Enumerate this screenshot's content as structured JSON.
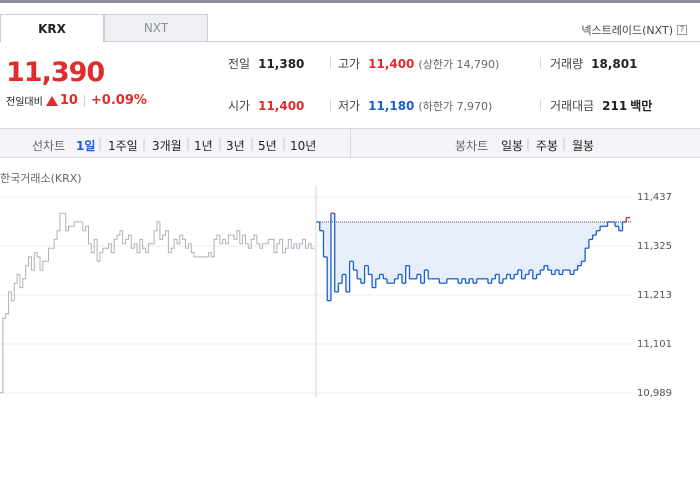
{
  "tabs": [
    {
      "label": "KRX",
      "active": true
    },
    {
      "label": "NXT",
      "active": false
    }
  ],
  "nxt_link": {
    "label": "넥스트레이드(NXT)",
    "help": "?"
  },
  "price": {
    "current": "11,390",
    "change_label": "전일대비",
    "change_value": "10",
    "change_percent": "+0.09%",
    "direction": "up"
  },
  "summary": {
    "prev_close": {
      "label": "전일",
      "value": "11,380"
    },
    "high": {
      "label": "고가",
      "value": "11,400",
      "sub": "(상한가 14,790)"
    },
    "volume": {
      "label": "거래량",
      "value": "18,801"
    },
    "open": {
      "label": "시가",
      "value": "11,400"
    },
    "low": {
      "label": "저가",
      "value": "11,180",
      "sub": "(하한가 7,970)"
    },
    "amount": {
      "label": "거래대금",
      "value": "211",
      "unit": "백만"
    }
  },
  "line_chart_tabs": {
    "label": "선차트",
    "items": [
      "1일",
      "1주일",
      "3개월",
      "1년",
      "3년",
      "5년",
      "10년"
    ],
    "active": "1일"
  },
  "candle_chart_tabs": {
    "label": "봉차트",
    "items": [
      "일봉",
      "주봉",
      "월봉"
    ]
  },
  "exchange_label": "한국거래소(KRX)",
  "colors": {
    "up": "#e12c2c",
    "down": "#1a5fcc",
    "fill": "#e6eef9"
  },
  "chart_data": {
    "type": "line",
    "y_ticks": [
      "11,437",
      "11,325",
      "11,213",
      "11,101",
      "10,989"
    ],
    "ylim": [
      10989,
      11437
    ],
    "reference_price": 11380,
    "grid": true,
    "series": [
      {
        "values": [
          10990,
          11160,
          11170,
          11220,
          11200,
          11240,
          11260,
          11230,
          11250,
          11280,
          11300,
          11270,
          11310,
          11300,
          11270,
          11290,
          11290,
          11320,
          11320,
          11340,
          11360,
          11400,
          11400,
          11360,
          11370,
          11370,
          11380,
          11380,
          11380,
          11360,
          11370,
          11330,
          11310,
          11340,
          11290,
          11310,
          11320,
          11320,
          11330,
          11310,
          11340,
          11350,
          11360,
          11330,
          11340,
          11350,
          11320,
          11330,
          11310,
          11340,
          11320,
          11310,
          11330,
          11330,
          11360,
          11380,
          11340,
          11350,
          11360,
          11310,
          11320,
          11340,
          11330,
          11350,
          11340,
          11320,
          11330,
          11310,
          11300,
          11300,
          11300,
          11300,
          11300,
          11310,
          11300,
          11340,
          11350,
          11330,
          11340,
          11330,
          11350,
          11350,
          11340,
          11360,
          11330,
          11350,
          11330,
          11320,
          11340,
          11350,
          11330,
          11320,
          11330,
          11330,
          11340,
          11340,
          11310,
          11330,
          11340,
          11310,
          11320,
          11340,
          11320,
          11330,
          11320,
          11330,
          11340,
          11320,
          11330,
          11320
        ]
      },
      {
        "values": [
          11380,
          11360,
          11300,
          11200,
          11400,
          11220,
          11240,
          11260,
          11220,
          11290,
          11270,
          11250,
          11240,
          11280,
          11260,
          11230,
          11250,
          11260,
          11250,
          11240,
          11240,
          11250,
          11260,
          11240,
          11280,
          11250,
          11250,
          11260,
          11240,
          11270,
          11250,
          11250,
          11250,
          11240,
          11240,
          11250,
          11250,
          11250,
          11240,
          11250,
          11240,
          11250,
          11240,
          11250,
          11250,
          11250,
          11240,
          11250,
          11260,
          11240,
          11250,
          11260,
          11250,
          11260,
          11270,
          11250,
          11260,
          11270,
          11250,
          11260,
          11270,
          11280,
          11270,
          11260,
          11270,
          11260,
          11270,
          11270,
          11260,
          11270,
          11280,
          11290,
          11320,
          11340,
          11350,
          11360,
          11370,
          11370,
          11380,
          11380,
          11370,
          11360,
          11380,
          11390
        ]
      }
    ]
  }
}
